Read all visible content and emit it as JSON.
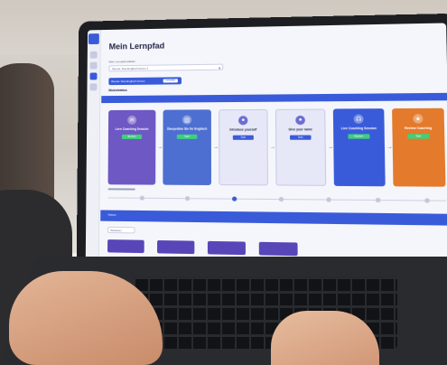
{
  "app": {
    "page_title": "Mein Lernpfad",
    "selector_label": "Mein Lernpfad wählen",
    "selector_value": "Berufe: Das Englisch lernen 1",
    "chip_label": "Berufe: Das Englisch lernen",
    "chip_button": "Lernpfad",
    "section_label": "Modulstatus"
  },
  "cards": [
    {
      "title": "Lern Coaching Session",
      "button": "Buchen",
      "color": "#6e58c4",
      "icon": "chat-icon"
    },
    {
      "title": "Überprüfen Sie Ihr Englisch",
      "button": "Start",
      "color": "#4d6fd1",
      "icon": "book-icon"
    },
    {
      "title": "Introduce yourself",
      "button": "Start",
      "color": "light",
      "icon": "user-icon"
    },
    {
      "title": "Give your name",
      "button": "Start",
      "color": "light",
      "icon": "user-icon"
    },
    {
      "title": "Live Coaching Session",
      "button": "Buchen",
      "color": "#3a5bd9",
      "icon": "headset-icon"
    },
    {
      "title": "Review Coaching",
      "button": "Start",
      "color": "#e37a2c",
      "icon": "star-icon"
    }
  ],
  "lower": {
    "bar_label": "Videos",
    "filter_value": "Sortieren"
  },
  "colors": {
    "accent": "#3a5bd9",
    "dark_bezel": "#1d1e22",
    "tile": "#5846b8"
  }
}
